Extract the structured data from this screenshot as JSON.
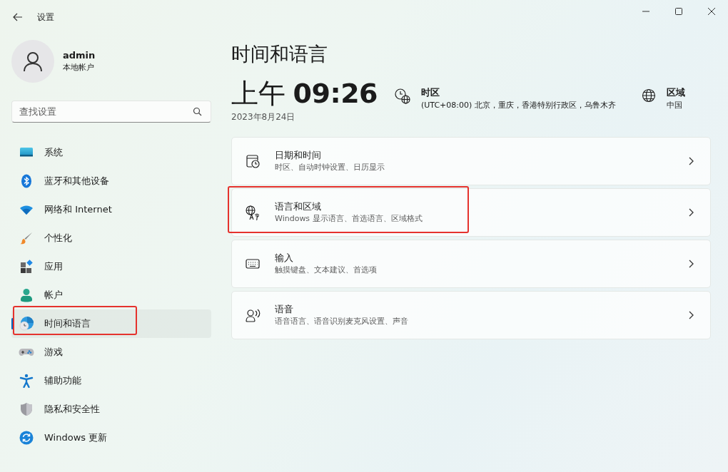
{
  "window": {
    "title": "设置"
  },
  "account": {
    "name": "admin",
    "type": "本地帐户"
  },
  "search": {
    "placeholder": "查找设置"
  },
  "sidebar": {
    "items": [
      {
        "kind": "system",
        "label": "系统",
        "selected": false,
        "highlighted": false
      },
      {
        "kind": "bluetooth",
        "label": "蓝牙和其他设备",
        "selected": false,
        "highlighted": false
      },
      {
        "kind": "network",
        "label": "网络和 Internet",
        "selected": false,
        "highlighted": false
      },
      {
        "kind": "personalize",
        "label": "个性化",
        "selected": false,
        "highlighted": false
      },
      {
        "kind": "apps",
        "label": "应用",
        "selected": false,
        "highlighted": false
      },
      {
        "kind": "accounts",
        "label": "帐户",
        "selected": false,
        "highlighted": false
      },
      {
        "kind": "time",
        "label": "时间和语言",
        "selected": true,
        "highlighted": true
      },
      {
        "kind": "gaming",
        "label": "游戏",
        "selected": false,
        "highlighted": false
      },
      {
        "kind": "accessibility",
        "label": "辅助功能",
        "selected": false,
        "highlighted": false
      },
      {
        "kind": "privacy",
        "label": "隐私和安全性",
        "selected": false,
        "highlighted": false
      },
      {
        "kind": "update",
        "label": "Windows 更新",
        "selected": false,
        "highlighted": false
      }
    ]
  },
  "page": {
    "title": "时间和语言",
    "time": "上午 **09:26**",
    "date": "2023年8月24日",
    "timezone": {
      "label": "时区",
      "value": "(UTC+08:00) 北京，重庆，香港特别行政区，乌鲁木齐"
    },
    "region": {
      "label": "区域",
      "value": "中国"
    },
    "cards": [
      {
        "kind": "datetime",
        "title": "日期和时间",
        "subtitle": "时区、自动时钟设置、日历显示",
        "highlighted": false
      },
      {
        "kind": "language",
        "title": "语言和区域",
        "subtitle": "Windows 显示语言、首选语言、区域格式",
        "highlighted": true
      },
      {
        "kind": "typing",
        "title": "输入",
        "subtitle": "触摸键盘、文本建议、首选项",
        "highlighted": false
      },
      {
        "kind": "speech",
        "title": "语音",
        "subtitle": "语音语言、语音识别麦克风设置、声音",
        "highlighted": false
      }
    ]
  }
}
